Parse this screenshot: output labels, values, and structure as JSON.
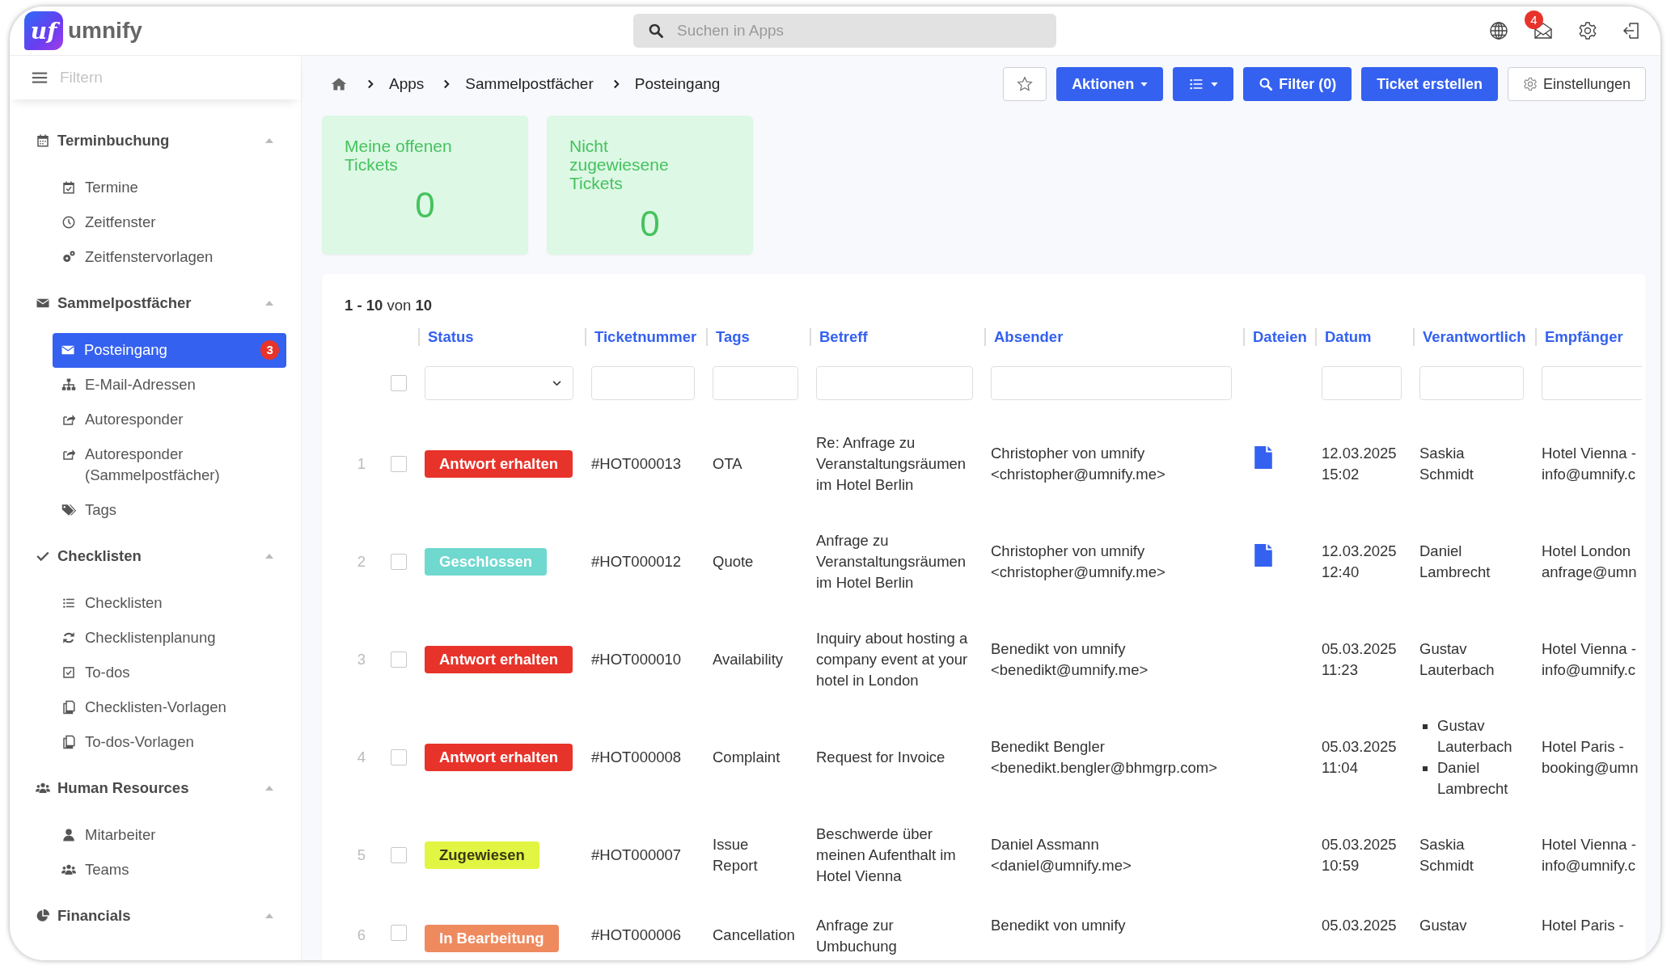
{
  "logo": {
    "mark": "uf",
    "name": "umnify"
  },
  "search": {
    "placeholder": "Suchen in Apps"
  },
  "topbar": {
    "notification_count": "4"
  },
  "sidebar": {
    "filter_placeholder": "Filtern",
    "sections": [
      {
        "label": "Terminbuchung",
        "expanded": true,
        "items": [
          {
            "label": "Termine",
            "selected": false
          },
          {
            "label": "Zeitfenster",
            "selected": false
          },
          {
            "label": "Zeitfenstervorlagen",
            "selected": false
          }
        ]
      },
      {
        "label": "Sammelpostfächer",
        "expanded": true,
        "items": [
          {
            "label": "Posteingang",
            "selected": true,
            "badge": "3"
          },
          {
            "label": "E-Mail-Adressen",
            "selected": false
          },
          {
            "label": "Autoresponder",
            "selected": false
          },
          {
            "label": "Autoresponder (Sammelpostfächer)",
            "selected": false
          },
          {
            "label": "Tags",
            "selected": false
          }
        ]
      },
      {
        "label": "Checklisten",
        "expanded": true,
        "items": [
          {
            "label": "Checklisten",
            "selected": false
          },
          {
            "label": "Checklistenplanung",
            "selected": false
          },
          {
            "label": "To-dos",
            "selected": false
          },
          {
            "label": "Checklisten-Vorlagen",
            "selected": false
          },
          {
            "label": "To-dos-Vorlagen",
            "selected": false
          }
        ]
      },
      {
        "label": "Human Resources",
        "expanded": true,
        "items": [
          {
            "label": "Mitarbeiter",
            "selected": false
          },
          {
            "label": "Teams",
            "selected": false
          }
        ]
      },
      {
        "label": "Financials",
        "expanded": true
      }
    ]
  },
  "breadcrumb": [
    "Apps",
    "Sammelpostfächer",
    "Posteingang"
  ],
  "toolbar": {
    "favorite": false,
    "buttons": [
      {
        "kind": "actions",
        "label": "Aktionen"
      },
      {
        "kind": "view"
      },
      {
        "kind": "filter",
        "label": "Filter (0)"
      },
      {
        "kind": "create",
        "label": "Ticket erstellen"
      },
      {
        "kind": "settings",
        "label": "Einstellungen"
      }
    ]
  },
  "cards": [
    {
      "title": "Meine offenen Tickets",
      "value": "0"
    },
    {
      "title": "Nicht zugewiesene Tickets",
      "value": "0"
    }
  ],
  "table": {
    "range": "**1 - 10** von **10**",
    "select_all_checked": false,
    "columns": [
      "Status",
      "Ticketnummer",
      "Tags",
      "Betreff",
      "Absender",
      "Dateien",
      "Datum",
      "Verantwortlich",
      "Empfänger"
    ],
    "rows": [
      {
        "number": "1",
        "checked": false,
        "status": "Antwort erhalten",
        "color": "#e8332a",
        "ticket": "#HOT000013",
        "tags": "OTA",
        "subject": "Re: Anfrage zu Veranstaltungsräumen im Hotel Berlin",
        "sender": [
          "Christopher von umnify",
          "<christopher@umnify.me>"
        ],
        "has_file": true,
        "date": [
          "12.03.2025",
          "15:02"
        ],
        "assignees": [
          "Saskia Schmidt"
        ],
        "recipient": [
          "Hotel Vienna -",
          "info@umnify.c"
        ]
      },
      {
        "number": "2",
        "checked": false,
        "status": "Geschlossen",
        "color": "#6fd8cf",
        "ticket": "#HOT000012",
        "tags": "Quote",
        "subject": "Anfrage zu Veranstaltungsräumen im Hotel Berlin",
        "sender": [
          "Christopher von umnify",
          "<christopher@umnify.me>"
        ],
        "has_file": true,
        "date": [
          "12.03.2025",
          "12:40"
        ],
        "assignees": [
          "Daniel Lambrecht"
        ],
        "recipient": [
          "Hotel London",
          "anfrage@umn"
        ]
      },
      {
        "number": "3",
        "checked": false,
        "status": "Antwort erhalten",
        "color": "#e8332a",
        "ticket": "#HOT000010",
        "tags": "Availability",
        "subject": "Inquiry about hosting a company event at your hotel in London",
        "sender": [
          "Benedikt von umnify",
          "<benedikt@umnify.me>"
        ],
        "has_file": false,
        "date": [
          "05.03.2025",
          "11:23"
        ],
        "assignees": [
          "Gustav Lauterbach"
        ],
        "recipient": [
          "Hotel Vienna -",
          "info@umnify.c"
        ]
      },
      {
        "number": "4",
        "checked": false,
        "status": "Antwort erhalten",
        "color": "#e8332a",
        "ticket": "#HOT000008",
        "tags": "Complaint",
        "subject": "Request for Invoice",
        "sender": [
          "Benedikt Bengler",
          "<benedikt.bengler@bhmgrp.com>"
        ],
        "has_file": false,
        "date": [
          "05.03.2025",
          "11:04"
        ],
        "assignees": [
          "Gustav Lauterbach",
          "Daniel Lambrecht"
        ],
        "recipient": [
          "Hotel Paris -",
          "booking@umn"
        ]
      },
      {
        "number": "5",
        "checked": false,
        "status": "Zugewiesen",
        "color": "#e2f542",
        "ticket": "#HOT000007",
        "tags": "Issue Report",
        "subject": "Beschwerde über meinen Aufenthalt im Hotel Vienna",
        "sender": [
          "Daniel Assmann",
          "<daniel@umnify.me>"
        ],
        "has_file": false,
        "date": [
          "05.03.2025",
          "10:59"
        ],
        "assignees": [
          "Saskia Schmidt"
        ],
        "recipient": [
          "Hotel Vienna -",
          "info@umnify.c"
        ]
      },
      {
        "number": "6",
        "checked": false,
        "status": "In Bearbeitung",
        "color": "#ef8a5f",
        "ticket": "#HOT000006",
        "tags": "Cancellation",
        "subject": "Anfrage zur Umbuchung",
        "sender": [
          "Benedikt von umnify"
        ],
        "has_file": false,
        "date": [
          "05.03.2025"
        ],
        "assignees": [
          "Gustav"
        ],
        "recipient": [
          "Hotel Paris -"
        ]
      }
    ]
  }
}
